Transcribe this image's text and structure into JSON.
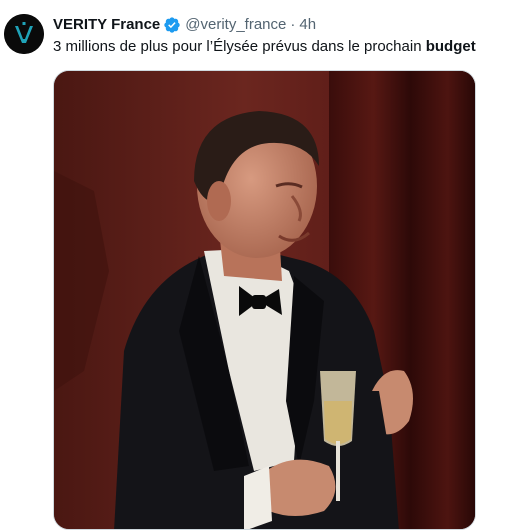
{
  "tweet": {
    "display_name": "VERITY France",
    "handle": "@verity_france",
    "separator": "·",
    "time": "4h",
    "text_main": "3 millions de plus pour l’Élysée prévus dans le prochain ",
    "text_bold": "budget",
    "avatar_icon": "verity-logo-icon",
    "verified_icon": "verified-badge-icon",
    "verified_color": "#1d9bf0"
  },
  "colors": {
    "text_primary": "#0f1419",
    "text_secondary": "#536471",
    "media_background": "#5a1f1a"
  }
}
